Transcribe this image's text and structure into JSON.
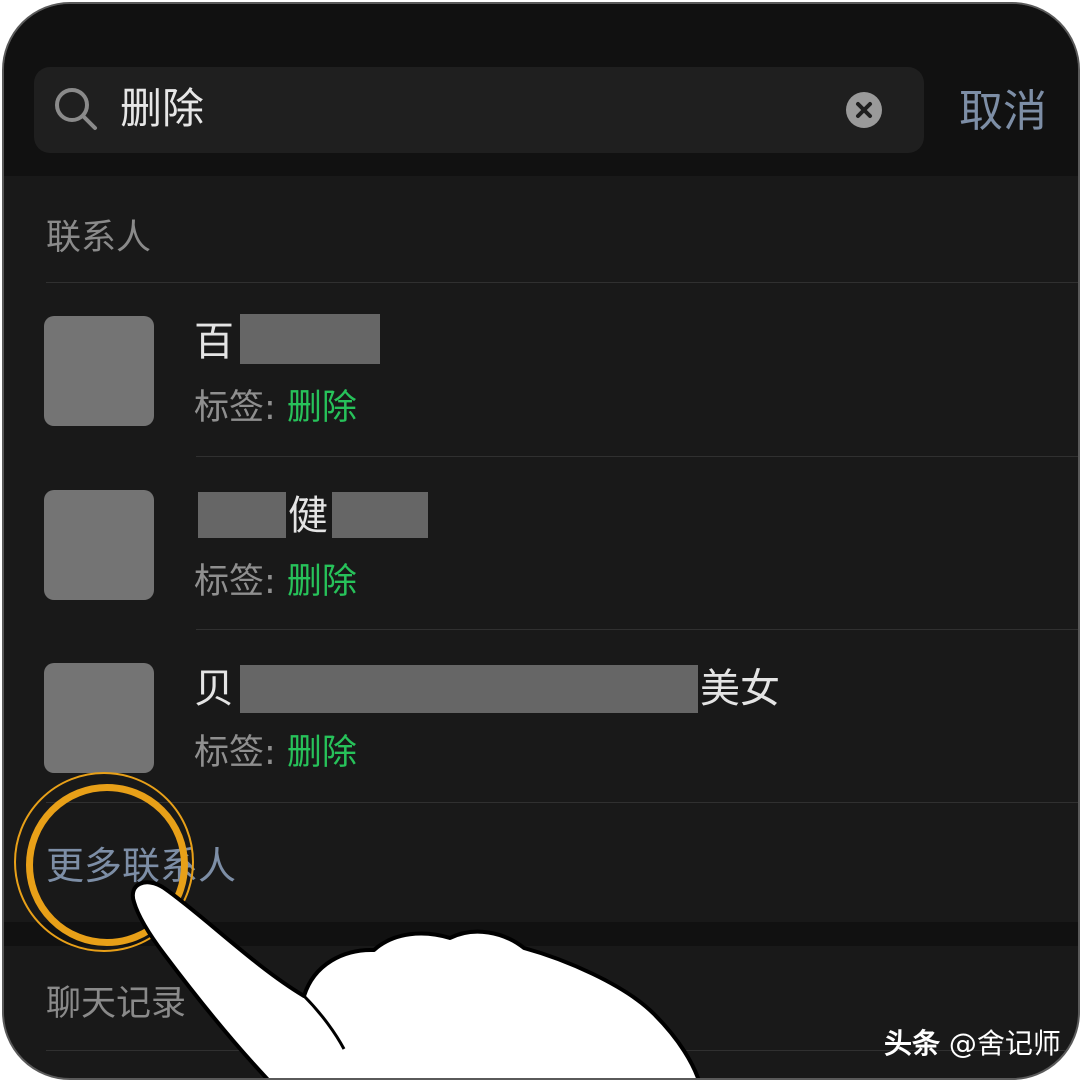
{
  "search": {
    "query": "删除",
    "cancel_label": "取消"
  },
  "sections": {
    "contacts_title": "联系人",
    "more_contacts_label": "更多联系人",
    "chat_records_title": "聊天记录"
  },
  "contacts": [
    {
      "name_visible_parts": [
        "百"
      ],
      "tag_prefix": "标签: ",
      "tag_value": "删除"
    },
    {
      "name_visible_parts": [
        "健"
      ],
      "tag_prefix": "标签: ",
      "tag_value": "删除"
    },
    {
      "name_visible_parts": [
        "贝",
        "美女"
      ],
      "tag_prefix": "标签: ",
      "tag_value": "删除"
    }
  ],
  "watermark": {
    "brand": "头条",
    "handle": "@舍记师"
  },
  "colors": {
    "background": "#191919",
    "accent_link": "#7d8ea6",
    "tag_highlight": "#27c25a",
    "annotation_ring": "#e8a018"
  },
  "icons": [
    "search-icon",
    "clear-icon",
    "tap-hand-icon"
  ]
}
